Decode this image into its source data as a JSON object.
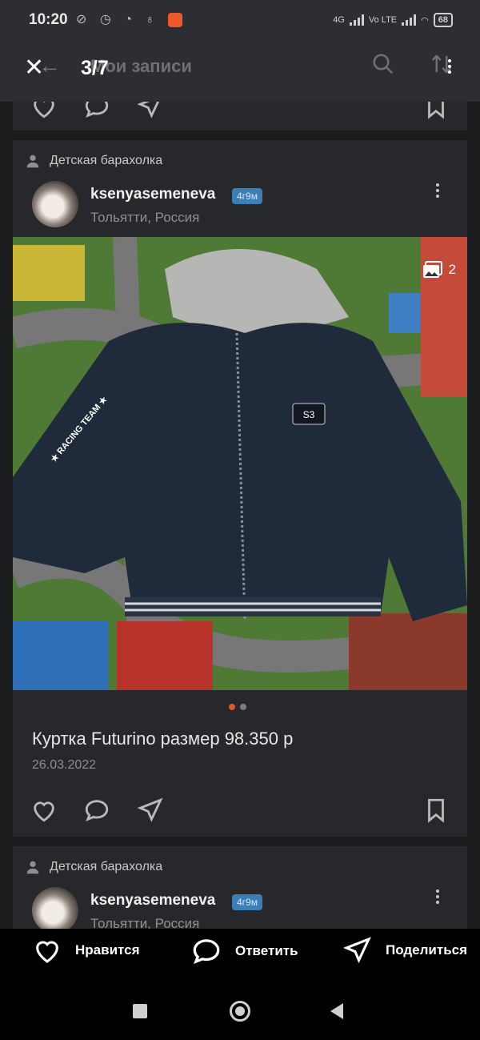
{
  "status_bar": {
    "time": "10:20",
    "left_icons": "⊘ ◷ ◔ ♁",
    "network": "4G",
    "volte": "Vo LTE",
    "battery": "68"
  },
  "header": {
    "counter": "3/7",
    "title": "Мои записи"
  },
  "posts": [
    {
      "group": "Детская барахолка",
      "username": "ksenyasemeneva",
      "age_badge": "4г9м",
      "location": "Тольятти, Россия",
      "photo_count": "2",
      "title": "Куртка Futurino размер 98.350 р",
      "date": "26.03.2022"
    },
    {
      "group": "Детская барахолка",
      "username": "ksenyasemeneva",
      "age_badge": "4г9м",
      "location": "Тольятти, Россия"
    }
  ],
  "photo_labels": {
    "sleeve_text": "★ RACING TEAM ★",
    "patch_text": "S3"
  },
  "bottom_actions": {
    "like_label": "Нравится",
    "reply_label": "Ответить",
    "share_label": "Поделиться"
  },
  "colors": {
    "accent": "#e8522b",
    "badge": "#3b7fb5",
    "background": "#26282b"
  }
}
